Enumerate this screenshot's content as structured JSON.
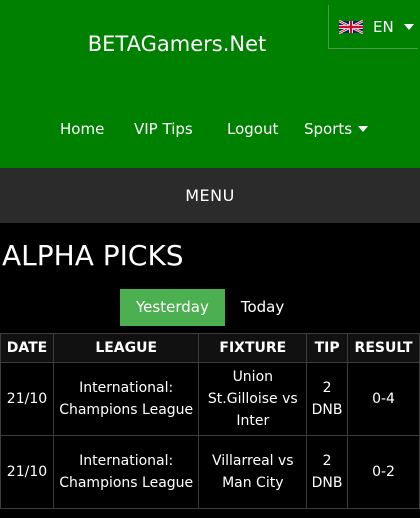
{
  "header": {
    "brand": "BETAGamers.Net",
    "language": "EN",
    "nav": [
      {
        "label": "Home"
      },
      {
        "label": "VIP Tips"
      },
      {
        "label": "Logout"
      },
      {
        "label": "Sports"
      }
    ]
  },
  "menu_label": "MENU",
  "page_title": "ALPHA PICKS",
  "tabs": [
    {
      "label": "Yesterday",
      "active": true
    },
    {
      "label": "Today",
      "active": false
    }
  ],
  "table": {
    "headers": [
      "DATE",
      "LEAGUE",
      "FIXTURE",
      "TIP",
      "RESULT"
    ],
    "rows": [
      {
        "date": "21/10",
        "league": "International: Champions League",
        "fixture": "Union St.Gilloise vs Inter",
        "tip": "2 DNB",
        "result": "0-4"
      },
      {
        "date": "21/10",
        "league": "International: Champions League",
        "fixture": "Villarreal vs Man City",
        "tip": "2 DNB",
        "result": "0-2"
      }
    ]
  },
  "colors": {
    "header_bg": "#008000",
    "menu_bg": "#2b2b2b",
    "active_tab": "#4caf50",
    "page_bg": "#000000"
  }
}
